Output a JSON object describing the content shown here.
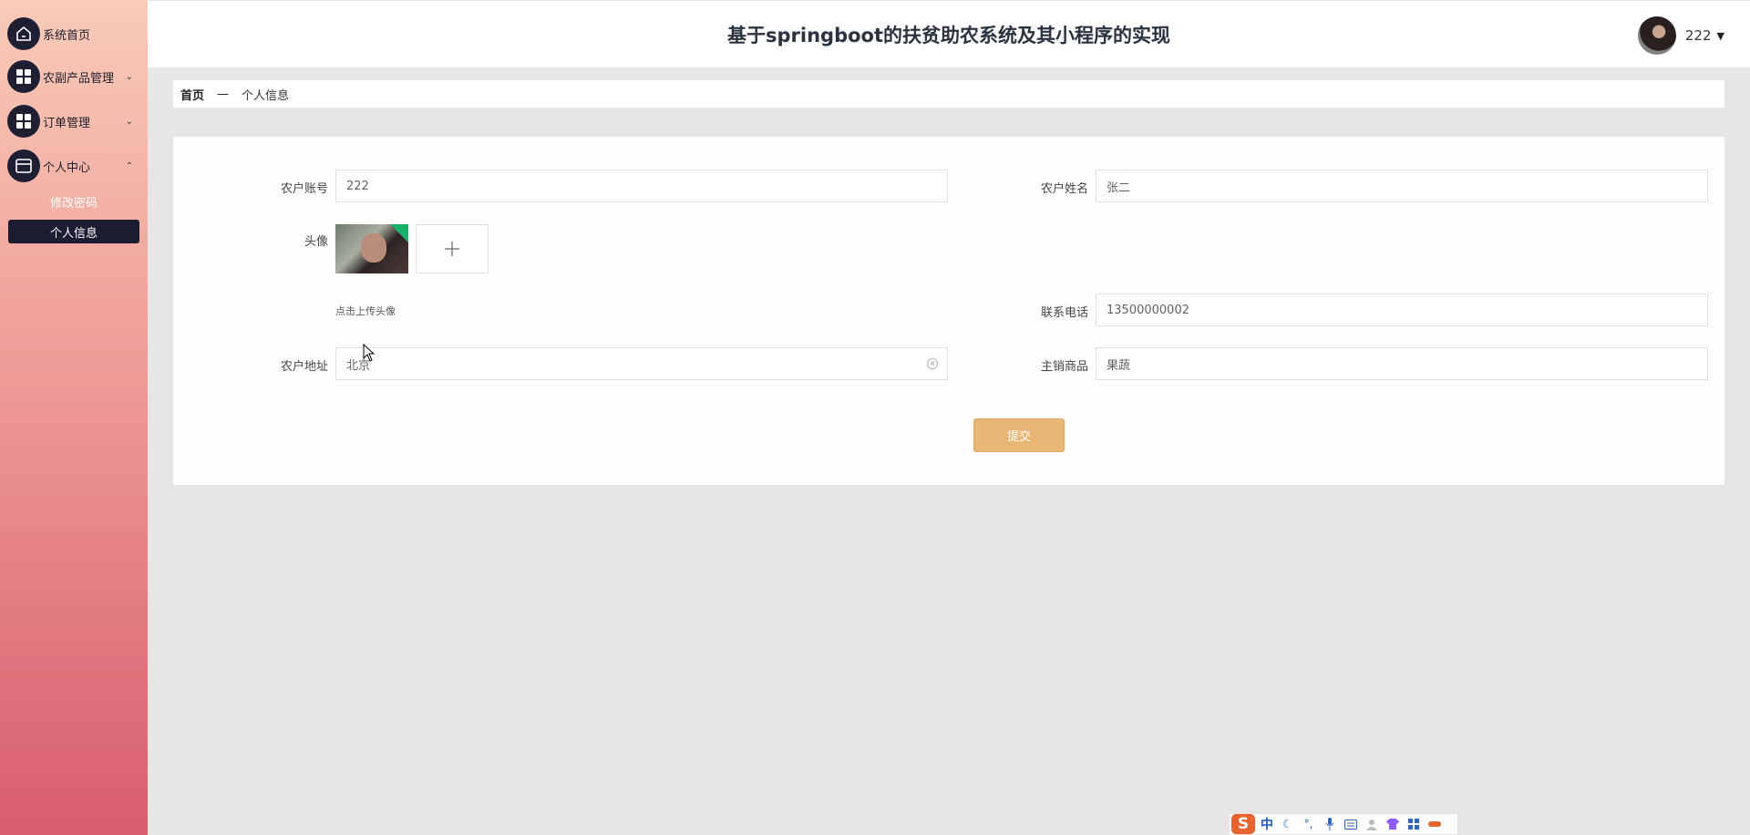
{
  "sidebar": {
    "items": [
      {
        "label": "系统首页",
        "icon": "home-icon"
      },
      {
        "label": "农副产品管理",
        "icon": "grid-icon",
        "arrow": "⌄"
      },
      {
        "label": "订单管理",
        "icon": "grid-icon",
        "arrow": "⌄"
      },
      {
        "label": "个人中心",
        "icon": "wallet-icon",
        "arrow": "⌃"
      }
    ],
    "sub_items": [
      {
        "label": "修改密码"
      },
      {
        "label": "个人信息",
        "active": true
      }
    ]
  },
  "header": {
    "title": "基于springboot的扶贫助农系统及其小程序的实现",
    "user_name": "222",
    "caret": "▼"
  },
  "breadcrumb": {
    "home": "首页",
    "separator": "—",
    "current": "个人信息"
  },
  "form": {
    "account_label": "农户账号",
    "account_value": "222",
    "name_label": "农户姓名",
    "name_value": "张二",
    "avatar_label": "头像",
    "upload_hint": "点击上传头像",
    "phone_label": "联系电话",
    "phone_value": "13500000002",
    "address_label": "农户地址",
    "address_value": "北京",
    "product_label": "主销商品",
    "product_value": "果蔬",
    "submit_label": "提交"
  },
  "ime": {
    "logo": "S",
    "mode": "中"
  },
  "colors": {
    "sidebar_top": "#f9cbb8",
    "sidebar_bottom": "#d85d6f",
    "menu_icon_bg": "#1e1f33",
    "active_item_bg": "#1c1d33",
    "submit_bg": "#e8b776",
    "page_bg": "#e8e5e5"
  }
}
